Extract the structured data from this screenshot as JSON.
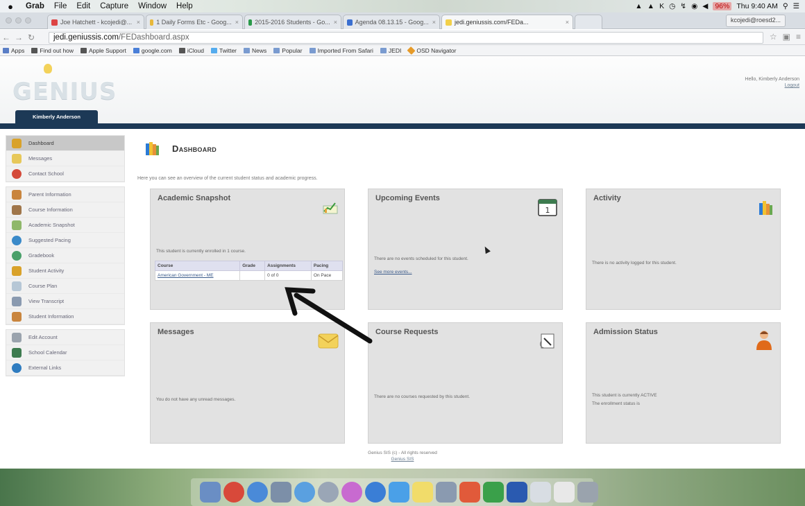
{
  "menubar": {
    "apple": "",
    "items": [
      "Grab",
      "File",
      "Edit",
      "Capture",
      "Window",
      "Help"
    ],
    "battery": "96%",
    "clock": "Thu 9:40 AM"
  },
  "tabs": [
    {
      "label": "Joe Hatchett - kcojedi@..."
    },
    {
      "label": "1 Daily Forms Etc - Goog..."
    },
    {
      "label": "2015-2016 Students - Go..."
    },
    {
      "label": "Agenda 08.13.15 - Goog..."
    },
    {
      "label": "jedi.geniussis.com/FEDa..."
    }
  ],
  "profile": "kcojedi@roesd2...",
  "address": {
    "host": "jedi.geniussis.com",
    "path": "/FEDashboard.aspx"
  },
  "bookmarks": [
    "Apps",
    "Find out how",
    "Apple Support",
    "google.com",
    "iCloud",
    "Twitter",
    "News",
    "Popular",
    "Imported From Safari",
    "JEDI",
    "OSD Navigator"
  ],
  "header": {
    "logo": "GENIUS",
    "user_tab": "Kimberly Anderson",
    "hello": "Hello, Kimberly Anderson",
    "logout": "Logout"
  },
  "sidebar": {
    "groups": [
      [
        {
          "label": "Dashboard",
          "icon": "books-icon",
          "color": "#d9a22a",
          "active": true
        },
        {
          "label": "Messages",
          "icon": "envelope-icon",
          "color": "#e7c85a"
        },
        {
          "label": "Contact School",
          "icon": "lifebuoy-icon",
          "color": "#d44a3a"
        }
      ],
      [
        {
          "label": "Parent Information",
          "icon": "parent-icon",
          "color": "#c9853e"
        },
        {
          "label": "Course Information",
          "icon": "teacher-icon",
          "color": "#a0764a"
        },
        {
          "label": "Academic Snapshot",
          "icon": "graph-icon",
          "color": "#8fb86a"
        },
        {
          "label": "Suggested Pacing",
          "icon": "globe-icon",
          "color": "#3a8ac9"
        },
        {
          "label": "Gradebook",
          "icon": "refresh-icon",
          "color": "#4aa06a"
        },
        {
          "label": "Student Activity",
          "icon": "books-icon",
          "color": "#d9a22a"
        },
        {
          "label": "Course Plan",
          "icon": "map-icon",
          "color": "#b6c7d6"
        },
        {
          "label": "View Transcript",
          "icon": "transcript-icon",
          "color": "#8a9ab0"
        },
        {
          "label": "Student Information",
          "icon": "student-icon",
          "color": "#c9853e"
        }
      ],
      [
        {
          "label": "Edit Account",
          "icon": "lock-icon",
          "color": "#9aa3ad"
        },
        {
          "label": "School Calendar",
          "icon": "calendar-icon",
          "color": "#3d7b4f"
        },
        {
          "label": "External Links",
          "icon": "globe-icon",
          "color": "#2f7cc0"
        }
      ]
    ]
  },
  "main": {
    "title": "Dashboard",
    "intro": "Here you can see an overview of the current student status and academic progress."
  },
  "panels": {
    "snapshot": {
      "title": "Academic Snapshot",
      "enrolled": "This student is currently enrolled in 1 course.",
      "columns": [
        "Course",
        "Grade",
        "Assignments",
        "Pacing"
      ],
      "rows": [
        {
          "course": "American Government - ME",
          "grade": "",
          "assignments": "0 of 0",
          "pacing": "On Pace"
        }
      ]
    },
    "events": {
      "title": "Upcoming Events",
      "text": "There are no events scheduled for this student.",
      "link": "See more events..."
    },
    "activity": {
      "title": "Activity",
      "text": "There is no activity logged for this student."
    },
    "messages": {
      "title": "Messages",
      "text": "You do not have any unread messages."
    },
    "requests": {
      "title": "Course Requests",
      "text": "There are no courses requested by this student."
    },
    "admission": {
      "title": "Admission Status",
      "text1": "This student is currently ACTIVE",
      "text2": "The enrollment status is"
    }
  },
  "footer": {
    "line1": "Genius SIS (c) - All rights reserved",
    "link": "Genius SIS"
  },
  "colors": {
    "navy": "#1c3956",
    "panel": "#e2e2e2",
    "link": "#3a5a8a"
  }
}
